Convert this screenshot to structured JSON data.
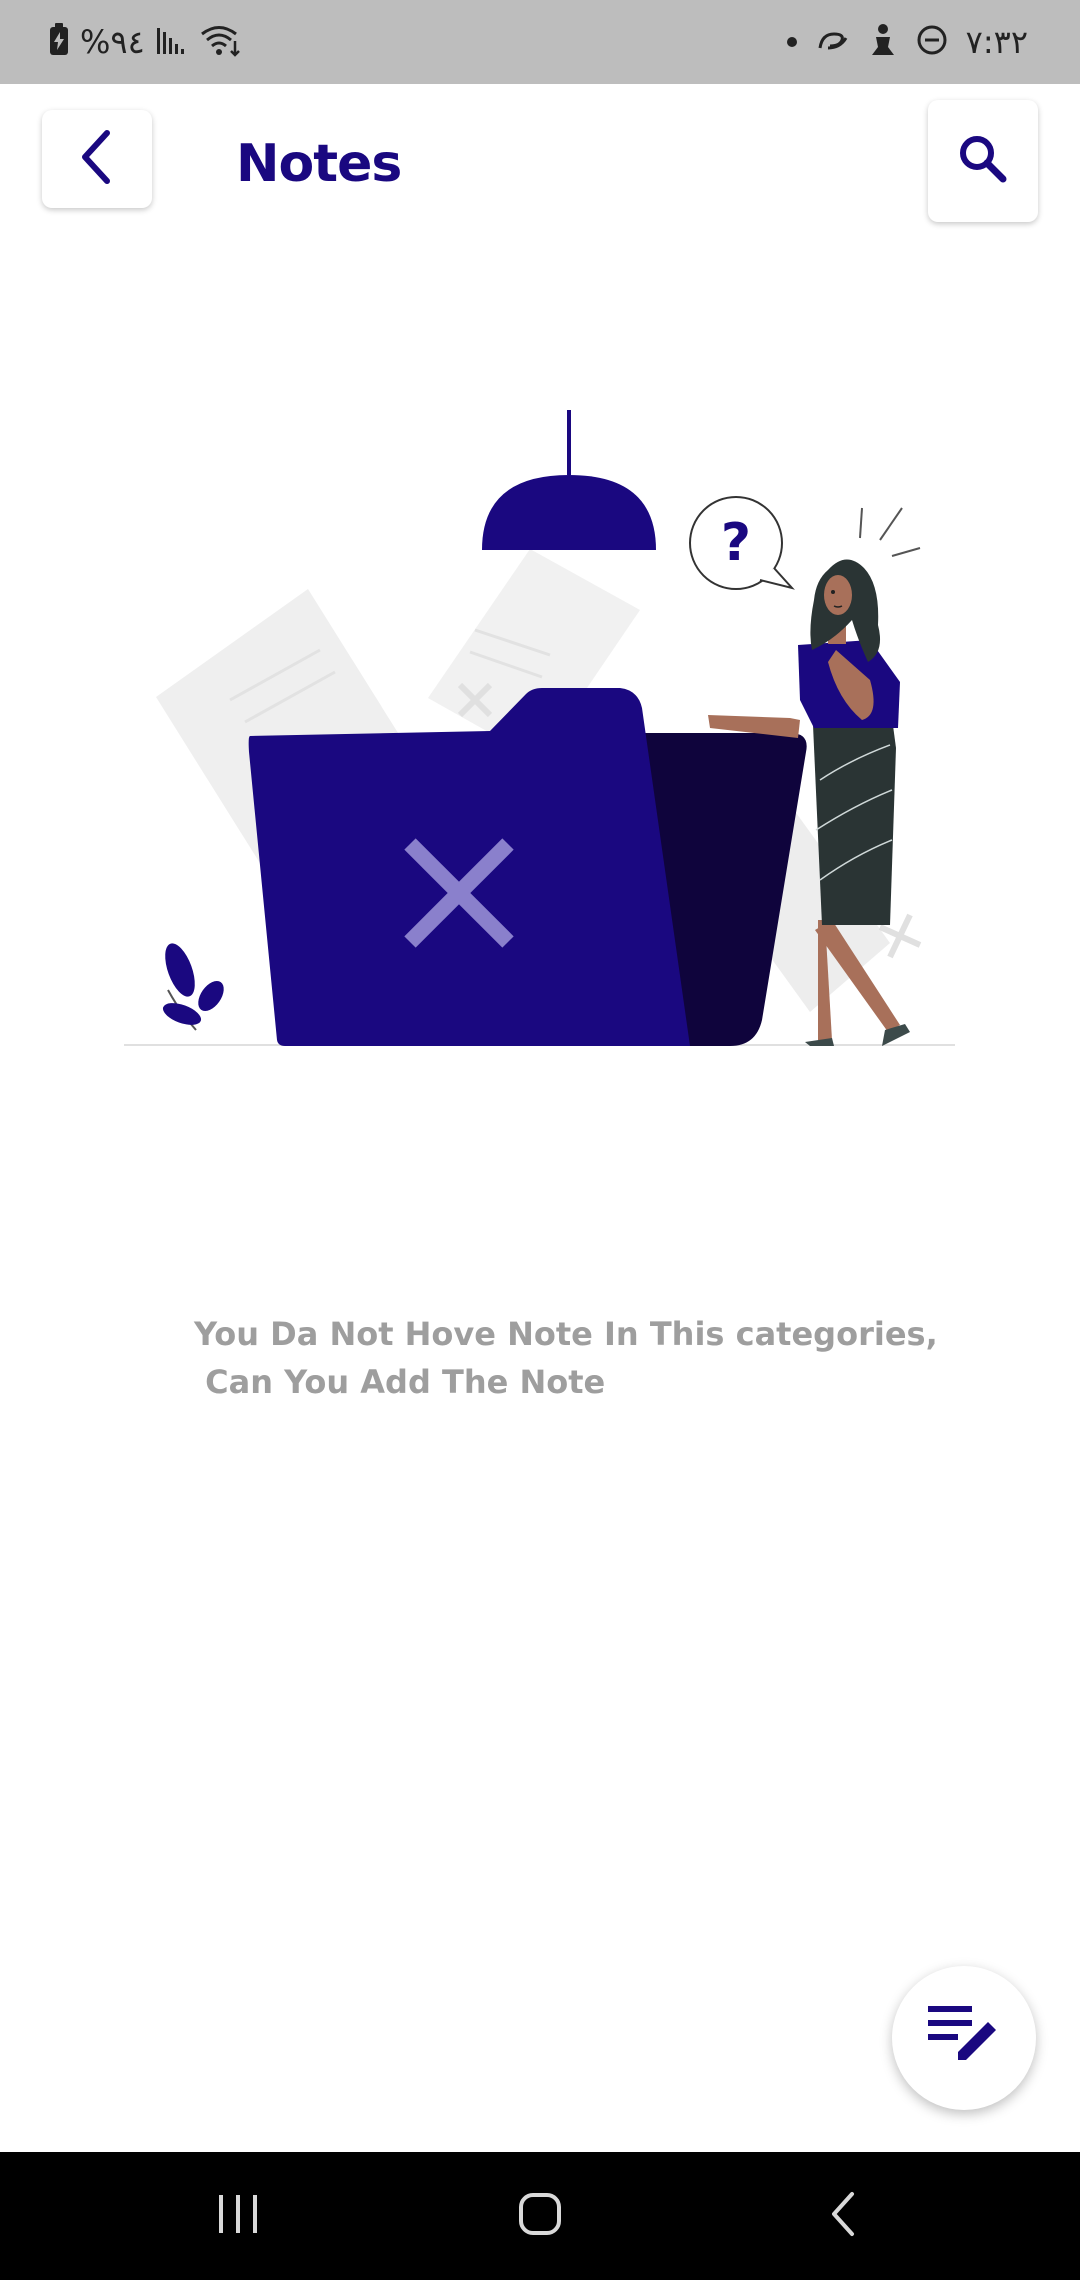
{
  "status_bar": {
    "battery_text": "%٩٤",
    "time_text": "٧:٣٢",
    "icons": [
      "battery-charging-icon",
      "signal-icon",
      "wifi-icon",
      "dot-icon",
      "link-icon",
      "accessibility-icon",
      "do-not-disturb-icon"
    ]
  },
  "header": {
    "title": "Notes",
    "back_icon": "chevron-left-icon",
    "search_icon": "search-icon"
  },
  "empty_state": {
    "illustration": "empty-folder-illustration",
    "line1": "You Da Not Hove Note In This categories,",
    "line2": " Can You Add The Note"
  },
  "fab": {
    "icon": "edit-note-icon"
  },
  "nav_bar": {
    "icons": [
      "recent-apps-icon",
      "home-icon",
      "back-icon"
    ]
  },
  "colors": {
    "primary": "#1a0880",
    "primary_dark": "#0f043c",
    "message_text": "#9e9e9e",
    "status_bar": "#bdbdbd"
  }
}
